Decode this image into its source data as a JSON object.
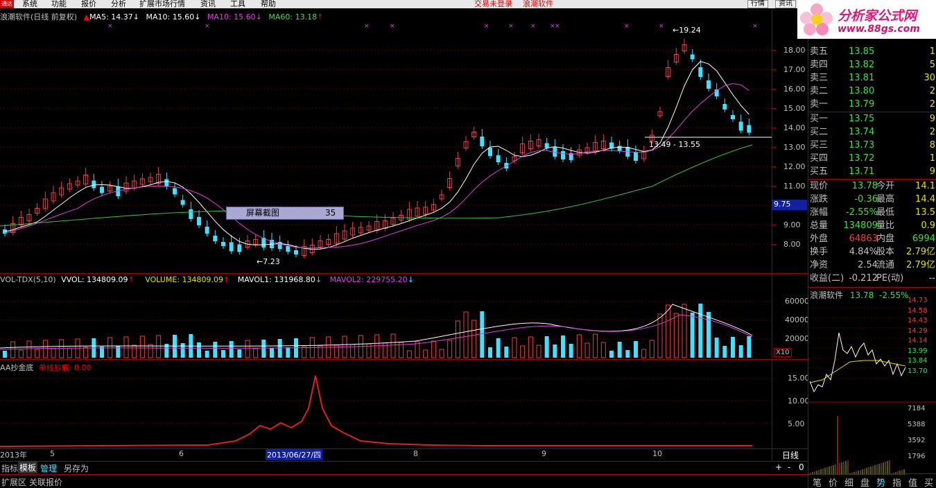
{
  "menu": {
    "logo": "通达",
    "items": [
      "系统",
      "功能",
      "报价",
      "分析",
      "扩展市场行情",
      "资讯",
      "工具",
      "帮助"
    ],
    "status1": "交易未登录",
    "status2": "浪潮软件",
    "btn_quote": "行情",
    "btn_trade": "资讯"
  },
  "brand": {
    "title": "分析家公式网",
    "url": "www.88gs.com"
  },
  "main_legend": {
    "name": "浪潮软件(日线 前复权)",
    "ma5": "MA5: 14.37",
    "ma10": "MA10: 15.60",
    "ma10b": "MA10: 15.60",
    "ma60": "MA60: 13.18"
  },
  "vol_legend": {
    "name": "VOL-TDX(5,10)",
    "vvol": "VVOL: 134809.09",
    "volume": "VOLUME: 134809.09",
    "mavol1": "MAVOL1: 131968.80",
    "mavol2": "MAVOL2: 229755.20"
  },
  "ind_legend": {
    "name": "AA抄金底",
    "line": "单线抄底: 0.00"
  },
  "price_axis": [
    "18.00",
    "17.00",
    "16.00",
    "15.00",
    "14.00",
    "13.00",
    "12.00",
    "11.00",
    "10.00",
    "9.00",
    "8.00"
  ],
  "cursor_price": "9.75",
  "vol_axis": [
    "60000",
    "40000",
    "20000"
  ],
  "vol_unit": "X10",
  "ind_axis": [
    "15.00",
    "10.00",
    "5.00"
  ],
  "annotations": {
    "high": "19.24",
    "low": "7.23",
    "range": "13.49 - 13.55"
  },
  "popup": {
    "label": "屏幕截图",
    "value": "35"
  },
  "date_axis": {
    "year": "2013年",
    "m5": "5",
    "m6": "6",
    "cursor_date": "2013/06/27/四",
    "m8": "8",
    "m9": "9",
    "m10": "10",
    "period": "日线"
  },
  "bottom_tabs": [
    "指标",
    "模板",
    "管理",
    "另存为"
  ],
  "bottom_tabs2": [
    "扩展区",
    "关联报价"
  ],
  "nav_buttons": [
    "+",
    "-",
    "0"
  ],
  "quote": {
    "sells": [
      {
        "label": "卖五",
        "price": "13.85",
        "vol": "1"
      },
      {
        "label": "卖四",
        "price": "13.82",
        "vol": "5"
      },
      {
        "label": "卖三",
        "price": "13.81",
        "vol": "30"
      },
      {
        "label": "卖二",
        "price": "13.80",
        "vol": "2"
      },
      {
        "label": "卖一",
        "price": "13.79",
        "vol": "2"
      }
    ],
    "buys": [
      {
        "label": "买一",
        "price": "13.75",
        "vol": "9"
      },
      {
        "label": "买二",
        "price": "13.74",
        "vol": "2"
      },
      {
        "label": "买三",
        "price": "13.73",
        "vol": "8"
      },
      {
        "label": "买四",
        "price": "13.72",
        "vol": "1"
      },
      {
        "label": "买五",
        "price": "13.71",
        "vol": "9"
      }
    ],
    "stats": [
      {
        "l1": "现价",
        "v1": "13.78",
        "l2": "今开",
        "v2": "14.1"
      },
      {
        "l1": "涨跌",
        "v1": "-0.36",
        "l2": "最高",
        "v2": "14.4"
      },
      {
        "l1": "涨幅",
        "v1": "-2.55%",
        "l2": "最低",
        "v2": "13.5"
      },
      {
        "l1": "总量",
        "v1": "134809",
        "l2": "量比",
        "v2": "0.9"
      },
      {
        "l1": "外盘",
        "v1": "64863",
        "l2": "内盘",
        "v2": "6994"
      },
      {
        "l1": "换手",
        "v1": "4.84%",
        "l2": "股本",
        "v2": "2.79亿"
      },
      {
        "l1": "净资",
        "v1": "2.54",
        "l2": "流通",
        "v2": "2.79亿"
      },
      {
        "l1": "收益(二)",
        "v1": "-0.212",
        "l2": "PE(动)",
        "v2": "--"
      }
    ]
  },
  "mini": {
    "name": "浪潮软件",
    "price": "13.78",
    "pct": "-2.55%",
    "axis": [
      "14.73",
      "14.58",
      "14.43",
      "14.29",
      "14.14",
      "13.99",
      "13.84",
      "13.70"
    ],
    "vol_axis": [
      "7184",
      "5388",
      "3592",
      "1796"
    ],
    "tabs": [
      "笔",
      "价",
      "细",
      "盘",
      "势",
      "指",
      "值",
      "买"
    ]
  }
}
